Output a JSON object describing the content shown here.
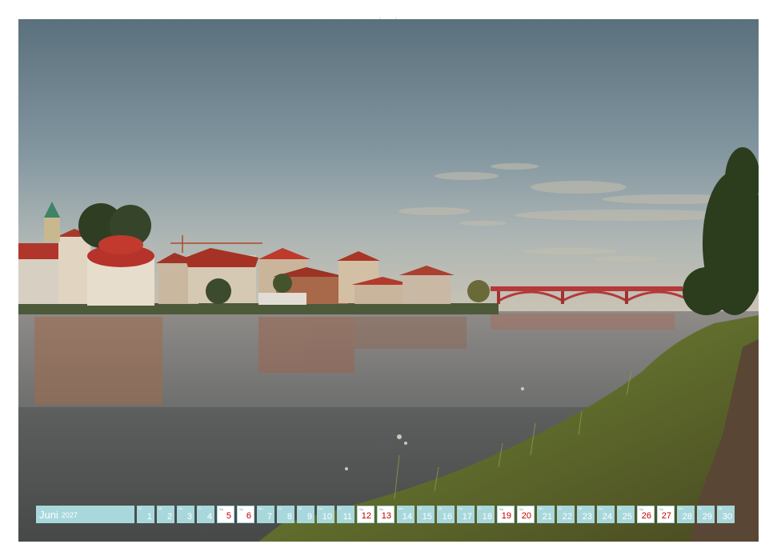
{
  "calendar": {
    "month": "Juni",
    "year": "2027",
    "days": [
      {
        "n": "1",
        "w": "Di",
        "t": "wd"
      },
      {
        "n": "2",
        "w": "Mi",
        "t": "wd"
      },
      {
        "n": "3",
        "w": "Do",
        "t": "wd"
      },
      {
        "n": "4",
        "w": "Fr",
        "t": "wd"
      },
      {
        "n": "5",
        "w": "Sa",
        "t": "sat"
      },
      {
        "n": "6",
        "w": "So",
        "t": "sun"
      },
      {
        "n": "7",
        "w": "Mo",
        "t": "wd"
      },
      {
        "n": "8",
        "w": "Di",
        "t": "wd"
      },
      {
        "n": "9",
        "w": "Mi",
        "t": "wd"
      },
      {
        "n": "10",
        "w": "Do",
        "t": "wd"
      },
      {
        "n": "11",
        "w": "Fr",
        "t": "wd"
      },
      {
        "n": "12",
        "w": "Sa",
        "t": "sat"
      },
      {
        "n": "13",
        "w": "So",
        "t": "sun"
      },
      {
        "n": "14",
        "w": "Mo",
        "t": "wd"
      },
      {
        "n": "15",
        "w": "Di",
        "t": "wd"
      },
      {
        "n": "16",
        "w": "Mi",
        "t": "wd"
      },
      {
        "n": "17",
        "w": "Do",
        "t": "wd"
      },
      {
        "n": "18",
        "w": "Fr",
        "t": "wd"
      },
      {
        "n": "19",
        "w": "Sa",
        "t": "sat"
      },
      {
        "n": "20",
        "w": "So",
        "t": "sun"
      },
      {
        "n": "21",
        "w": "Mo",
        "t": "wd"
      },
      {
        "n": "22",
        "w": "Di",
        "t": "wd"
      },
      {
        "n": "23",
        "w": "Mi",
        "t": "wd"
      },
      {
        "n": "24",
        "w": "Do",
        "t": "wd"
      },
      {
        "n": "25",
        "w": "Fr",
        "t": "wd"
      },
      {
        "n": "26",
        "w": "Sa",
        "t": "sat"
      },
      {
        "n": "27",
        "w": "So",
        "t": "sun"
      },
      {
        "n": "28",
        "w": "Mo",
        "t": "wd"
      },
      {
        "n": "29",
        "w": "Di",
        "t": "wd"
      },
      {
        "n": "30",
        "w": "Mi",
        "t": "wd"
      }
    ]
  },
  "colors": {
    "calendar_accent": "#a8d8dc",
    "weekend_number": "#c00000"
  }
}
